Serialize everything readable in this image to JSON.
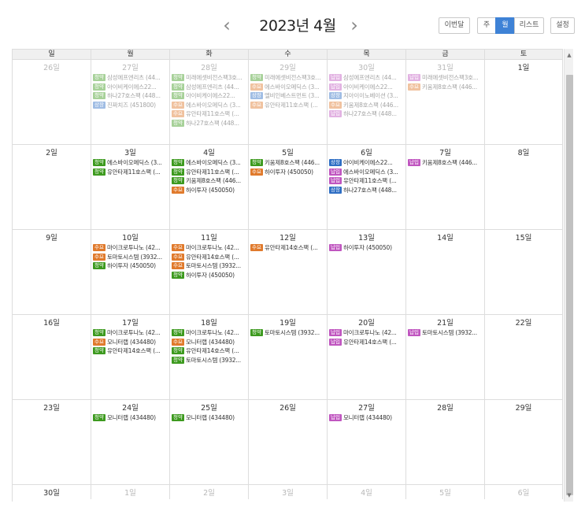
{
  "header": {
    "title": "2023년 4월",
    "prev_icon": "‹",
    "next_icon": "›",
    "today_label": "이번달",
    "week_label": "주",
    "month_label": "월",
    "list_label": "리스트",
    "settings_label": "설정"
  },
  "scrollbar": {
    "up": "▲",
    "down": "▼"
  },
  "colors": {
    "청약": "#3d9a1f",
    "수요": "#e07a2c",
    "상장": "#2f6fc4",
    "납입": "#c056c0",
    "accent": "#3e82d6"
  },
  "weekdays": [
    "일",
    "월",
    "화",
    "수",
    "목",
    "금",
    "토"
  ],
  "weeks": [
    [
      {
        "day": "26일",
        "other": true,
        "events": []
      },
      {
        "day": "27일",
        "other": true,
        "events": [
          {
            "type": "청약",
            "text": "삼성에프엔리츠 (44..."
          },
          {
            "type": "청약",
            "text": "아이비케이에스22..."
          },
          {
            "type": "청약",
            "text": "하나27호스팩 (448..."
          },
          {
            "type": "상장",
            "text": "진짜치즈 (451800)"
          }
        ]
      },
      {
        "day": "28일",
        "other": true,
        "events": [
          {
            "type": "청약",
            "text": "미래에셋비전스팩3호..."
          },
          {
            "type": "청약",
            "text": "삼성에프엔리츠 (44..."
          },
          {
            "type": "청약",
            "text": "아이비케이에스22..."
          },
          {
            "type": "수요",
            "text": "에스바이오메딕스 (3..."
          },
          {
            "type": "수요",
            "text": "유안타제11호스팩 (..."
          },
          {
            "type": "청약",
            "text": "하나27호스팩 (448..."
          }
        ]
      },
      {
        "day": "29일",
        "other": true,
        "events": [
          {
            "type": "청약",
            "text": "미래에셋비전스팩3호..."
          },
          {
            "type": "수요",
            "text": "에스바이오메딕스 (3..."
          },
          {
            "type": "상장",
            "text": "엘비인베스트먼트 (3..."
          },
          {
            "type": "수요",
            "text": "유안타제11호스팩 (..."
          }
        ]
      },
      {
        "day": "30일",
        "other": true,
        "events": [
          {
            "type": "납입",
            "text": "삼성에프엔리츠 (44..."
          },
          {
            "type": "납입",
            "text": "아이비케이에스22..."
          },
          {
            "type": "상장",
            "text": "지아이이노베이션 (3..."
          },
          {
            "type": "수요",
            "text": "키움제8호스팩 (446..."
          },
          {
            "type": "납입",
            "text": "하나27호스팩 (448..."
          }
        ]
      },
      {
        "day": "31일",
        "other": true,
        "events": [
          {
            "type": "납입",
            "text": "미래에셋비전스팩3호..."
          },
          {
            "type": "수요",
            "text": "키움제8호스팩 (446..."
          }
        ]
      },
      {
        "day": "1일",
        "other": false,
        "events": []
      }
    ],
    [
      {
        "day": "2일",
        "other": false,
        "events": []
      },
      {
        "day": "3일",
        "other": false,
        "events": [
          {
            "type": "청약",
            "text": "에스바이오메딕스 (3..."
          },
          {
            "type": "청약",
            "text": "유안타제11호스팩 (..."
          }
        ]
      },
      {
        "day": "4일",
        "other": false,
        "events": [
          {
            "type": "청약",
            "text": "에스바이오메딕스 (3..."
          },
          {
            "type": "청약",
            "text": "유안타제11호스팩 (..."
          },
          {
            "type": "청약",
            "text": "키움제8호스팩 (446..."
          },
          {
            "type": "수요",
            "text": "하이투자 (450050)"
          }
        ]
      },
      {
        "day": "5일",
        "other": false,
        "events": [
          {
            "type": "청약",
            "text": "키움제8호스팩 (446..."
          },
          {
            "type": "수요",
            "text": "하이투자 (450050)"
          }
        ]
      },
      {
        "day": "6일",
        "other": false,
        "events": [
          {
            "type": "상장",
            "text": "아이비케이에스22..."
          },
          {
            "type": "납입",
            "text": "에스바이오메딕스 (3..."
          },
          {
            "type": "납입",
            "text": "유안타제11호스팩 (..."
          },
          {
            "type": "상장",
            "text": "하나27호스팩 (448..."
          }
        ]
      },
      {
        "day": "7일",
        "other": false,
        "events": [
          {
            "type": "납입",
            "text": "키움제8호스팩 (446..."
          }
        ]
      },
      {
        "day": "8일",
        "other": false,
        "events": []
      }
    ],
    [
      {
        "day": "9일",
        "other": false,
        "events": []
      },
      {
        "day": "10일",
        "other": false,
        "events": [
          {
            "type": "수요",
            "text": "마이크로투나노 (42..."
          },
          {
            "type": "수요",
            "text": "토마토시스템 (3932..."
          },
          {
            "type": "청약",
            "text": "하이투자 (450050)"
          }
        ]
      },
      {
        "day": "11일",
        "other": false,
        "events": [
          {
            "type": "수요",
            "text": "마이크로투나노 (42..."
          },
          {
            "type": "수요",
            "text": "유안타제14호스팩 (..."
          },
          {
            "type": "수요",
            "text": "토마토시스템 (3932..."
          },
          {
            "type": "청약",
            "text": "하이투자 (450050)"
          }
        ]
      },
      {
        "day": "12일",
        "other": false,
        "events": [
          {
            "type": "수요",
            "text": "유안타제14호스팩 (..."
          }
        ]
      },
      {
        "day": "13일",
        "other": false,
        "events": [
          {
            "type": "납입",
            "text": "하이투자 (450050)"
          }
        ]
      },
      {
        "day": "14일",
        "other": false,
        "events": []
      },
      {
        "day": "15일",
        "other": false,
        "events": []
      }
    ],
    [
      {
        "day": "16일",
        "other": false,
        "events": []
      },
      {
        "day": "17일",
        "other": false,
        "events": [
          {
            "type": "청약",
            "text": "마이크로투나노 (42..."
          },
          {
            "type": "수요",
            "text": "모니터랩 (434480)"
          },
          {
            "type": "청약",
            "text": "유안타제14호스팩 (..."
          }
        ]
      },
      {
        "day": "18일",
        "other": false,
        "events": [
          {
            "type": "청약",
            "text": "마이크로투나노 (42..."
          },
          {
            "type": "수요",
            "text": "모니터랩 (434480)"
          },
          {
            "type": "청약",
            "text": "유안타제14호스팩 (..."
          },
          {
            "type": "청약",
            "text": "토마토시스템 (3932..."
          }
        ]
      },
      {
        "day": "19일",
        "other": false,
        "events": [
          {
            "type": "청약",
            "text": "토마토시스템 (3932..."
          }
        ]
      },
      {
        "day": "20일",
        "other": false,
        "events": [
          {
            "type": "납입",
            "text": "마이크로투나노 (42..."
          },
          {
            "type": "납입",
            "text": "유안타제14호스팩 (..."
          }
        ]
      },
      {
        "day": "21일",
        "other": false,
        "events": [
          {
            "type": "납입",
            "text": "토마토시스템 (3932..."
          }
        ]
      },
      {
        "day": "22일",
        "other": false,
        "events": []
      }
    ],
    [
      {
        "day": "23일",
        "other": false,
        "events": []
      },
      {
        "day": "24일",
        "other": false,
        "events": [
          {
            "type": "청약",
            "text": "모니터랩 (434480)"
          }
        ]
      },
      {
        "day": "25일",
        "other": false,
        "events": [
          {
            "type": "청약",
            "text": "모니터랩 (434480)"
          }
        ]
      },
      {
        "day": "26일",
        "other": false,
        "events": []
      },
      {
        "day": "27일",
        "other": false,
        "events": [
          {
            "type": "납입",
            "text": "모니터랩 (434480)"
          }
        ]
      },
      {
        "day": "28일",
        "other": false,
        "events": []
      },
      {
        "day": "29일",
        "other": false,
        "events": []
      }
    ],
    [
      {
        "day": "30일",
        "other": false,
        "events": []
      },
      {
        "day": "1일",
        "other": true,
        "events": []
      },
      {
        "day": "2일",
        "other": true,
        "events": []
      },
      {
        "day": "3일",
        "other": true,
        "events": []
      },
      {
        "day": "4일",
        "other": true,
        "events": []
      },
      {
        "day": "5일",
        "other": true,
        "events": []
      },
      {
        "day": "6일",
        "other": true,
        "events": []
      }
    ]
  ]
}
